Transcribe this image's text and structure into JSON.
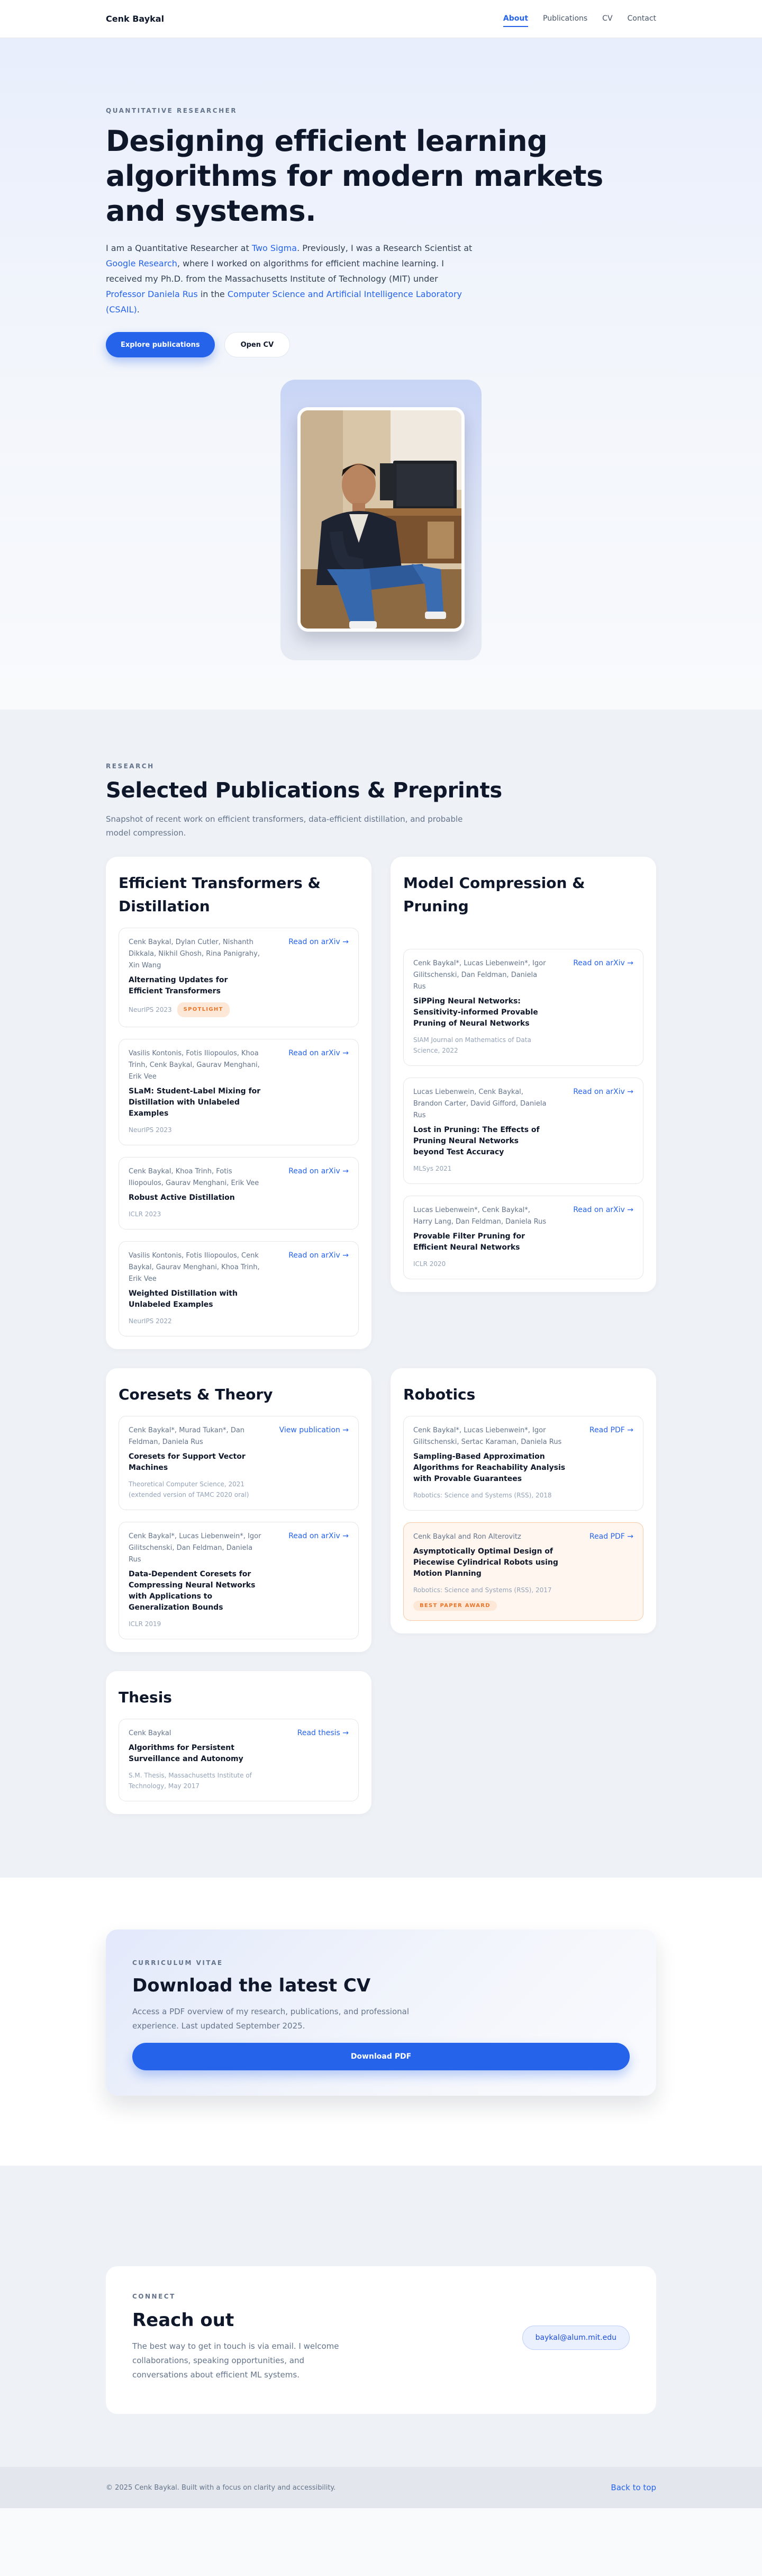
{
  "nav": {
    "brand": "Cenk Baykal",
    "links": [
      {
        "label": "About",
        "active": true
      },
      {
        "label": "Publications",
        "active": false
      },
      {
        "label": "CV",
        "active": false
      },
      {
        "label": "Contact",
        "active": false
      }
    ]
  },
  "hero": {
    "eyebrow": "QUANTITATIVE RESEARCHER",
    "title": "Designing efficient learning algorithms for modern markets and systems.",
    "bio": {
      "t1": "I am a Quantitative Researcher at ",
      "l1": "Two Sigma",
      "t2": ". Previously, I was a Research Scientist at ",
      "l2": "Google Research",
      "t3": ", where I worked on algorithms for efficient machine learning. I received my Ph.D. from the Massachusetts Institute of Technology (MIT) under ",
      "l3": "Professor Daniela Rus",
      "t4": " in the ",
      "l4": "Computer Science and Artificial Intelligence Laboratory (CSAIL)",
      "t5": "."
    },
    "primary_button": "Explore publications",
    "secondary_button": "Open CV",
    "photo_icon": "portrait-photo"
  },
  "research": {
    "eyebrow": "RESEARCH",
    "title": "Selected Publications & Preprints",
    "subtitle": "Snapshot of recent work on efficient transformers, data-efficient distillation, and probable model compression.",
    "groups": [
      {
        "title": "Efficient Transformers & Distillation",
        "pubs": [
          {
            "authors": "Cenk Baykal, Dylan Cutler, Nishanth Dikkala, Nikhil Ghosh, Rina Panigrahy, Xin Wang",
            "title": "Alternating Updates for Efficient Transformers",
            "venue": "NeurIPS 2023",
            "badge": "SPOTLIGHT",
            "link": "Read on arXiv →"
          },
          {
            "authors": "Vasilis Kontonis, Fotis Iliopoulos, Khoa Trinh, Cenk Baykal, Gaurav Menghani, Erik Vee",
            "title": "SLaM: Student-Label Mixing for Distillation with Unlabeled Examples",
            "venue": "NeurIPS 2023",
            "badge": "",
            "link": "Read on arXiv →"
          },
          {
            "authors": "Cenk Baykal, Khoa Trinh, Fotis Iliopoulos, Gaurav Menghani, Erik Vee",
            "title": "Robust Active Distillation",
            "venue": "ICLR 2023",
            "badge": "",
            "link": "Read on arXiv →"
          },
          {
            "authors": "Vasilis Kontonis, Fotis Iliopoulos, Cenk Baykal, Gaurav Menghani, Khoa Trinh, Erik Vee",
            "title": "Weighted Distillation with Unlabeled Examples",
            "venue": "NeurIPS 2022",
            "badge": "",
            "link": "Read on arXiv →"
          }
        ]
      },
      {
        "title": "Model Compression & Pruning",
        "pubs": [
          {
            "authors": "Cenk Baykal*, Lucas Liebenwein*, Igor Gilitschenski, Dan Feldman, Daniela Rus",
            "title": "SiPPing Neural Networks: Sensitivity-informed Provable Pruning of Neural Networks",
            "venue": "SIAM Journal on Mathematics of Data Science, 2022",
            "badge": "",
            "link": "Read on arXiv →"
          },
          {
            "authors": "Lucas Liebenwein, Cenk Baykal, Brandon Carter, David Gifford, Daniela Rus",
            "title": "Lost in Pruning: The Effects of Pruning Neural Networks beyond Test Accuracy",
            "venue": "MLSys 2021",
            "badge": "",
            "link": "Read on arXiv →"
          },
          {
            "authors": "Lucas Liebenwein*, Cenk Baykal*, Harry Lang, Dan Feldman, Daniela Rus",
            "title": "Provable Filter Pruning for Efficient Neural Networks",
            "venue": "ICLR 2020",
            "badge": "",
            "link": "Read on arXiv →"
          }
        ]
      },
      {
        "title": "Coresets & Theory",
        "pubs": [
          {
            "authors": "Cenk Baykal*, Murad Tukan*, Dan Feldman, Daniela Rus",
            "title": "Coresets for Support Vector Machines",
            "venue": "Theoretical Computer Science, 2021 (extended version of TAMC 2020 oral)",
            "badge": "",
            "link": "View publication →"
          },
          {
            "authors": "Cenk Baykal*, Lucas Liebenwein*, Igor Gilitschenski, Dan Feldman, Daniela Rus",
            "title": "Data-Dependent Coresets for Compressing Neural Networks with Applications to Generalization Bounds",
            "venue": "ICLR 2019",
            "badge": "",
            "link": "Read on arXiv →"
          }
        ]
      },
      {
        "title": "Robotics",
        "pubs": [
          {
            "authors": "Cenk Baykal*, Lucas Liebenwein*, Igor Gilitschenski, Sertac Karaman, Daniela Rus",
            "title": "Sampling-Based Approximation Algorithms for Reachability Analysis with Provable Guarantees",
            "venue": "Robotics: Science and Systems (RSS), 2018",
            "badge": "",
            "link": "Read PDF →",
            "award": false
          },
          {
            "authors": "Cenk Baykal and Ron Alterovitz",
            "title": "Asymptotically Optimal Design of Piecewise Cylindrical Robots using Motion Planning",
            "venue": "Robotics: Science and Systems (RSS), 2017",
            "badge": "BEST PAPER AWARD",
            "link": "Read PDF →",
            "award": true
          }
        ]
      },
      {
        "title": "Thesis",
        "pubs": [
          {
            "authors": "Cenk Baykal",
            "title": "Algorithms for Persistent Surveillance and Autonomy",
            "venue": "S.M. Thesis, Massachusetts Institute of Technology, May 2017",
            "badge": "",
            "link": "Read thesis →"
          }
        ]
      }
    ]
  },
  "cv": {
    "eyebrow": "CURRICULUM VITAE",
    "title": "Download the latest CV",
    "text": "Access a PDF overview of my research, publications, and professional experience. Last updated September 2025.",
    "button": "Download PDF"
  },
  "contact": {
    "eyebrow": "CONNECT",
    "title": "Reach out",
    "text": "The best way to get in touch is via email. I welcome collaborations, speaking opportunities, and conversations about efficient ML systems.",
    "email": "baykal@alum.mit.edu"
  },
  "footer": {
    "text": "© 2025 Cenk Baykal. Built with a focus on clarity and accessibility.",
    "back_to_top": "Back to top"
  }
}
